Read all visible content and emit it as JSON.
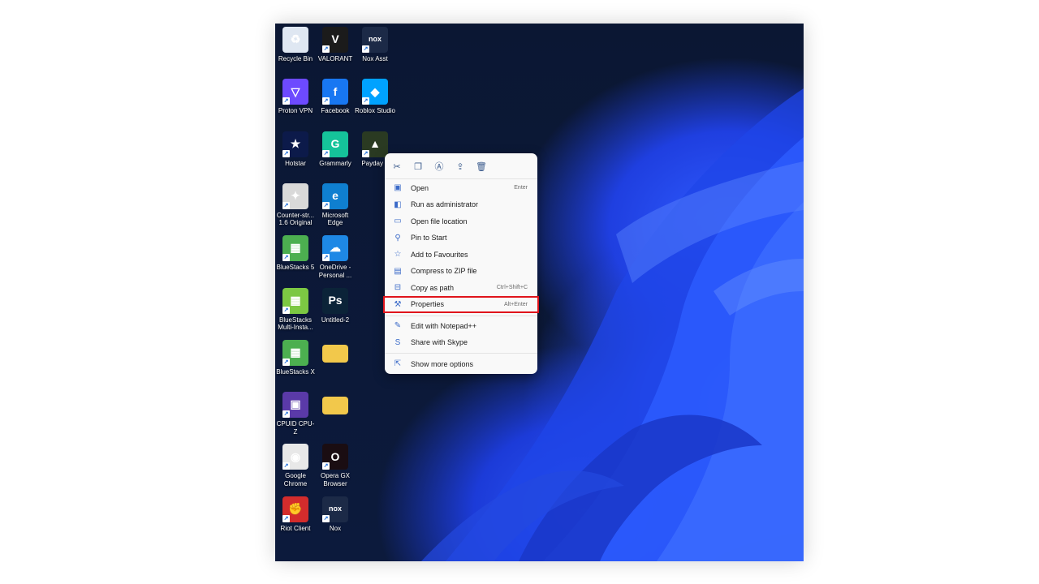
{
  "desktop": {
    "icons": [
      {
        "label": "Recycle Bin",
        "icon": "recycle-bin-icon",
        "bg": "#dfe7f2",
        "glyph": "♻",
        "shortcut": false
      },
      {
        "label": "VALORANT",
        "icon": "valorant-icon",
        "bg": "#1b1b1b",
        "glyph": "V",
        "shortcut": true
      },
      {
        "label": "Nox Asst",
        "icon": "nox-assistant-icon",
        "bg": "#1c2a47",
        "glyph": "nox",
        "shortcut": true
      },
      {
        "label": "Proton VPN",
        "icon": "proton-vpn-icon",
        "bg": "#6d4aff",
        "glyph": "▽",
        "shortcut": true
      },
      {
        "label": "Facebook",
        "icon": "facebook-icon",
        "bg": "#1877f2",
        "glyph": "f",
        "shortcut": true
      },
      {
        "label": "Roblox Studio",
        "icon": "roblox-studio-icon",
        "bg": "#00a2ff",
        "glyph": "◆",
        "shortcut": true
      },
      {
        "label": "Hotstar",
        "icon": "hotstar-icon",
        "bg": "#0c1a4a",
        "glyph": "★",
        "shortcut": true
      },
      {
        "label": "Grammarly",
        "icon": "grammarly-icon",
        "bg": "#15c39a",
        "glyph": "G",
        "shortcut": true
      },
      {
        "label": "Payday 2",
        "icon": "payday-icon",
        "bg": "#2a3a22",
        "glyph": "▲",
        "shortcut": true
      },
      {
        "label": "Counter-str... 1.6 Original",
        "icon": "counter-strike-icon",
        "bg": "#d9d9d9",
        "glyph": "✦",
        "shortcut": true
      },
      {
        "label": "Microsoft Edge",
        "icon": "edge-icon",
        "bg": "#0f7fd0",
        "glyph": "e",
        "shortcut": true
      },
      {
        "label": "BlueStacks 5",
        "icon": "bluestacks-icon",
        "bg": "#4caf50",
        "glyph": "▦",
        "shortcut": true
      },
      {
        "label": "OneDrive - Personal ...",
        "icon": "onedrive-icon",
        "bg": "#1e88e5",
        "glyph": "☁",
        "shortcut": true
      },
      {
        "label": "BlueStacks Multi-Insta...",
        "icon": "bluestacks-multi-icon",
        "bg": "#7cc843",
        "glyph": "▦",
        "shortcut": true
      },
      {
        "label": "Untitled-2",
        "icon": "photoshop-file-icon",
        "bg": "#0b2338",
        "glyph": "Ps",
        "shortcut": false
      },
      {
        "label": "BlueStacks X",
        "icon": "bluestacks-x-icon",
        "bg": "#4caf50",
        "glyph": "▦",
        "shortcut": true
      },
      {
        "label": "",
        "icon": "folder-icon",
        "bg": "#f2c84b",
        "glyph": "",
        "shortcut": false
      },
      {
        "label": "CPUID CPU-Z",
        "icon": "cpu-z-icon",
        "bg": "#5a3aa8",
        "glyph": "▣",
        "shortcut": true
      },
      {
        "label": "",
        "icon": "folder-icon",
        "bg": "#f2c84b",
        "glyph": "",
        "shortcut": false
      },
      {
        "label": "Google Chrome",
        "icon": "chrome-icon",
        "bg": "#e8e8e8",
        "glyph": "◉",
        "shortcut": true
      },
      {
        "label": "Opera GX Browser",
        "icon": "opera-gx-icon",
        "bg": "#1a0d12",
        "glyph": "O",
        "shortcut": true
      },
      {
        "label": "Riot Client",
        "icon": "riot-client-icon",
        "bg": "#d32c2c",
        "glyph": "✊",
        "shortcut": true
      },
      {
        "label": "Nox",
        "icon": "nox-icon",
        "bg": "#1c2a47",
        "glyph": "nox",
        "shortcut": true
      }
    ]
  },
  "context_menu": {
    "quick_actions": [
      {
        "name": "cut-icon",
        "glyph": "✂"
      },
      {
        "name": "copy-icon",
        "glyph": "❐"
      },
      {
        "name": "rename-icon",
        "glyph": "Ⓐ"
      },
      {
        "name": "share-icon",
        "glyph": "⇪"
      },
      {
        "name": "delete-icon",
        "glyph": "🗑"
      }
    ],
    "items": [
      {
        "label": "Open",
        "shortcut": "Enter",
        "icon": "open-icon",
        "glyph": "▣"
      },
      {
        "label": "Run as administrator",
        "shortcut": "",
        "icon": "shield-icon",
        "glyph": "◧"
      },
      {
        "label": "Open file location",
        "shortcut": "",
        "icon": "folder-icon",
        "glyph": "▭"
      },
      {
        "label": "Pin to Start",
        "shortcut": "",
        "icon": "pin-icon",
        "glyph": "⚲"
      },
      {
        "label": "Add to Favourites",
        "shortcut": "",
        "icon": "star-icon",
        "glyph": "☆"
      },
      {
        "label": "Compress to ZIP file",
        "shortcut": "",
        "icon": "zip-icon",
        "glyph": "▤"
      },
      {
        "label": "Copy as path",
        "shortcut": "Ctrl+Shift+C",
        "icon": "path-icon",
        "glyph": "⊟"
      },
      {
        "label": "Properties",
        "shortcut": "Alt+Enter",
        "icon": "wrench-icon",
        "glyph": "⚒"
      },
      {
        "label": "Edit with Notepad++",
        "shortcut": "",
        "icon": "notepad-plus-plus-icon",
        "glyph": "✎"
      },
      {
        "label": "Share with Skype",
        "shortcut": "",
        "icon": "skype-icon",
        "glyph": "S"
      },
      {
        "label": "Show more options",
        "shortcut": "",
        "icon": "more-options-icon",
        "glyph": "⇱"
      }
    ]
  }
}
